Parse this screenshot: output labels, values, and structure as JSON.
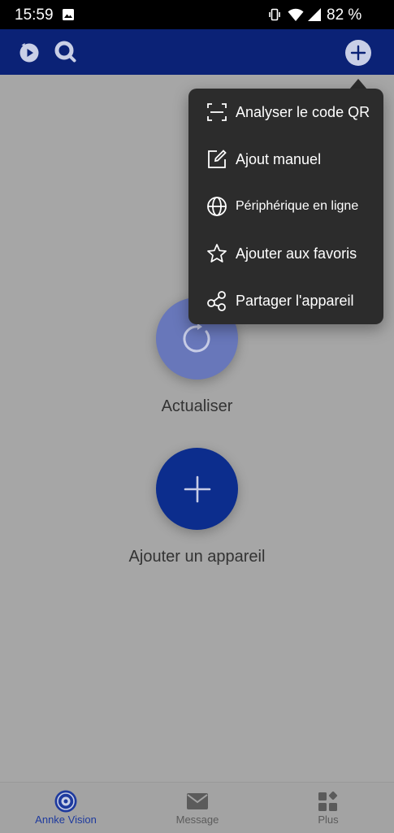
{
  "status_bar": {
    "time": "15:59",
    "battery": "82 %"
  },
  "app_bar": {
    "icons": [
      "playback-icon",
      "search-icon",
      "add-icon"
    ]
  },
  "main": {
    "refresh_label": "Actualiser",
    "add_device_label": "Ajouter un appareil"
  },
  "menu": {
    "items": [
      {
        "label": "Analyser le code QR",
        "icon": "qr-scan-icon"
      },
      {
        "label": "Ajout manuel",
        "icon": "edit-icon"
      },
      {
        "label": "Périphérique en ligne",
        "icon": "globe-icon"
      },
      {
        "label": "Ajouter aux favoris",
        "icon": "star-icon"
      },
      {
        "label": "Partager l'appareil",
        "icon": "share-icon"
      }
    ]
  },
  "bottom_nav": {
    "items": [
      {
        "label": "Annke Vision",
        "icon": "annke-vision-icon",
        "active": true
      },
      {
        "label": "Message",
        "icon": "message-icon",
        "active": false
      },
      {
        "label": "Plus",
        "icon": "plus-grid-icon",
        "active": false
      }
    ]
  },
  "colors": {
    "app_bar": "#0b2276",
    "overlay_bg": "#a6a6a6",
    "menu_bg": "#2c2c2c",
    "add_button": "#0c2d8d",
    "refresh_button": "#6877ba",
    "active_tab": "#1e3a9e"
  }
}
